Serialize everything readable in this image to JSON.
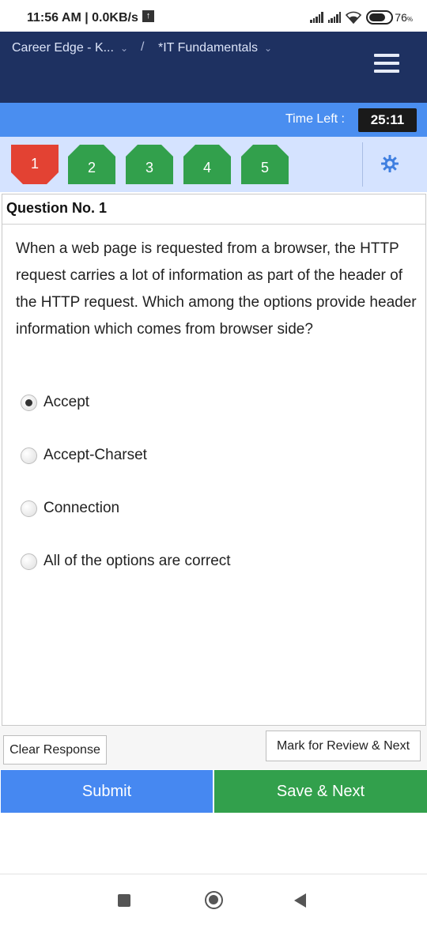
{
  "status_bar": {
    "time": "11:56 AM | 0.0KB/s",
    "battery_percent": "76",
    "battery_unit": "%",
    "icons": [
      "upload-arrow-icon",
      "signal-icon",
      "signal-icon",
      "wifi-icon",
      "battery-icon"
    ]
  },
  "header": {
    "breadcrumb_course": "Career Edge - K...",
    "breadcrumb_separator": "/",
    "breadcrumb_section": "*IT Fundamentals",
    "menu_icon": "hamburger-menu-icon",
    "background_color": "#1e3161"
  },
  "timer": {
    "label": "Time Left :",
    "value": "25:11",
    "bar_color": "#4a8ef0"
  },
  "palette": {
    "questions": [
      {
        "number": "1",
        "state": "current-not-answered",
        "color": "#e34233"
      },
      {
        "number": "2",
        "state": "answered",
        "color": "#32a04c"
      },
      {
        "number": "3",
        "state": "answered",
        "color": "#32a04c"
      },
      {
        "number": "4",
        "state": "answered",
        "color": "#32a04c"
      },
      {
        "number": "5",
        "state": "answered",
        "color": "#32a04c"
      }
    ],
    "settings_icon": "gear-icon"
  },
  "question": {
    "heading": "Question No. 1",
    "text": "When a web page is requested from a browser, the HTTP request carries a lot of information as part of the header of the HTTP request. Which among the options provide header information which comes from browser side?",
    "options": [
      {
        "label": "Accept",
        "selected": true
      },
      {
        "label": "Accept-Charset",
        "selected": false
      },
      {
        "label": "Connection",
        "selected": false
      },
      {
        "label": "All of the options are correct",
        "selected": false
      }
    ]
  },
  "actions": {
    "clear_label": "Clear Response",
    "mark_label": "Mark for Review & Next",
    "submit_label": "Submit",
    "save_label": "Save & Next",
    "submit_color": "#4688f1",
    "save_color": "#32a04c"
  },
  "nav_bar": {
    "icons": [
      "recents-square-icon",
      "home-circle-icon",
      "back-triangle-icon"
    ]
  }
}
